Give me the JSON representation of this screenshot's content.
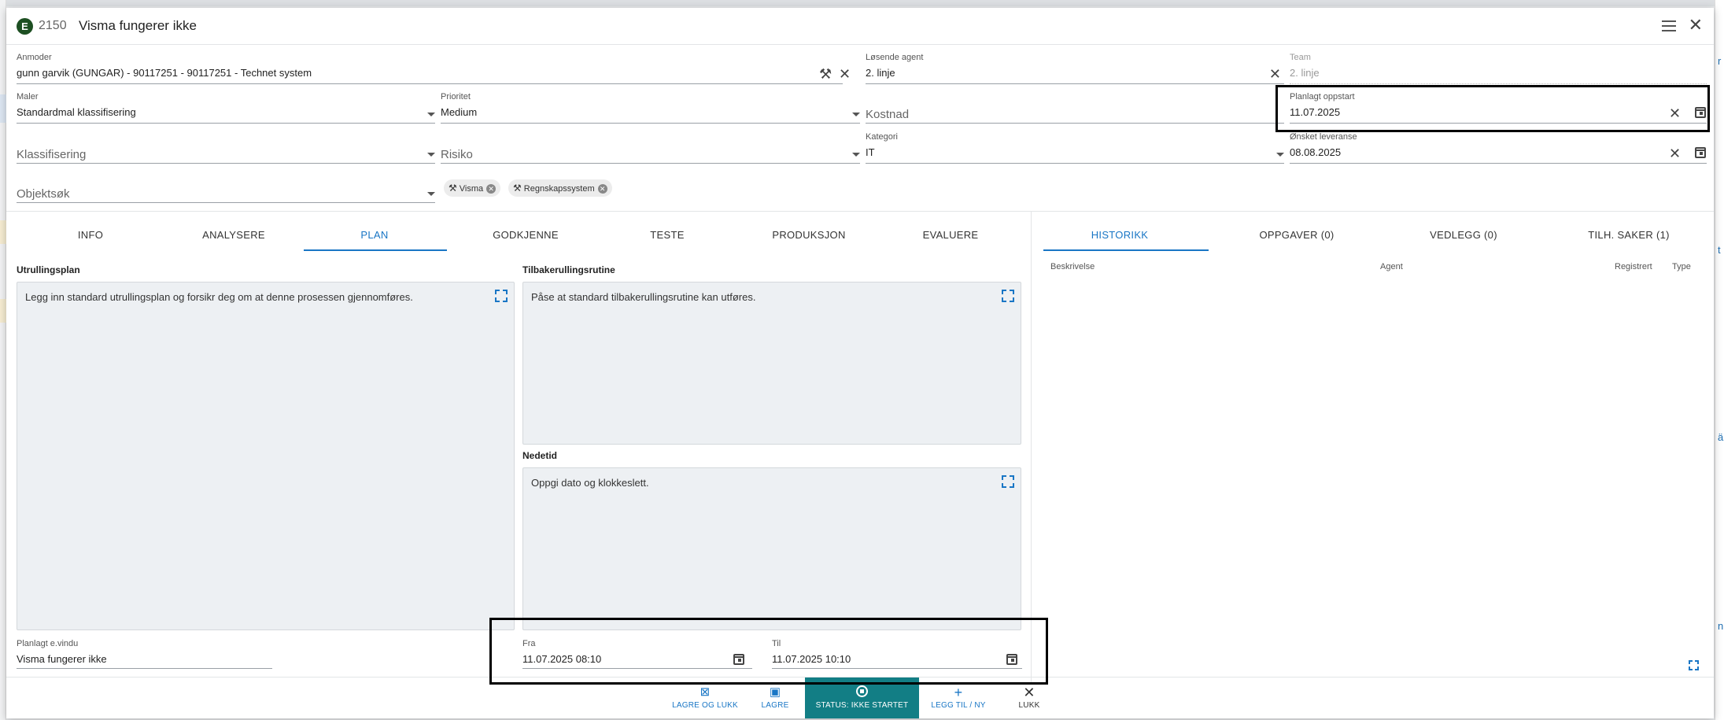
{
  "header": {
    "badge": "E",
    "ticket_number": "2150",
    "title": "Visma fungerer ikke"
  },
  "form": {
    "anmoder": {
      "label": "Anmoder",
      "value": "gunn garvik (GUNGAR) - 90117251 - 90117251 - Technet system"
    },
    "losende_agent": {
      "label": "Løsende agent",
      "value": "2. linje"
    },
    "team": {
      "label": "Team",
      "value": "2. linje"
    },
    "maler": {
      "label": "Maler",
      "value": "Standardmal klassifisering"
    },
    "prioritet": {
      "label": "Prioritet",
      "value": "Medium"
    },
    "kostnad": {
      "placeholder": "Kostnad"
    },
    "planlagt_oppstart": {
      "label": "Planlagt oppstart",
      "value": "11.07.2025"
    },
    "klassifisering": {
      "placeholder": "Klassifisering"
    },
    "risiko": {
      "placeholder": "Risiko"
    },
    "kategori": {
      "label": "Kategori",
      "value": "IT"
    },
    "onsket_leveranse": {
      "label": "Ønsket leveranse",
      "value": "08.08.2025"
    },
    "objektsok": {
      "placeholder": "Objektsøk"
    },
    "chips": [
      "Visma",
      "Regnskapssystem"
    ]
  },
  "left_tabs": [
    "INFO",
    "ANALYSERE",
    "PLAN",
    "GODKJENNE",
    "TESTE",
    "PRODUKSJON",
    "EVALUERE"
  ],
  "active_left_tab": "PLAN",
  "right_tabs": [
    "HISTORIKK",
    "OPPGAVER (0)",
    "VEDLEGG (0)",
    "TILH. SAKER (1)"
  ],
  "active_right_tab": "HISTORIKK",
  "plan": {
    "utrullingsplan": {
      "label": "Utrullingsplan",
      "text": "Legg inn standard utrullingsplan og forsikr deg om at denne prosessen gjennomføres."
    },
    "tilbakerulling": {
      "label": "Tilbakerullingsrutine",
      "text": "Påse at standard tilbakerullingsrutine kan utføres."
    },
    "nedetid": {
      "label": "Nedetid",
      "text": "Oppgi dato og klokkeslett."
    },
    "planlagt_evindu": {
      "label": "Planlagt e.vindu",
      "value": "Visma fungerer ikke"
    },
    "fra": {
      "label": "Fra",
      "value": "11.07.2025 08:10"
    },
    "til": {
      "label": "Til",
      "value": "11.07.2025 10:10"
    }
  },
  "history_columns": [
    "Beskrivelse",
    "Agent",
    "Registrert",
    "Type"
  ],
  "footer": {
    "lagre_og_lukk": "LAGRE OG LUKK",
    "lagre": "LAGRE",
    "status": "STATUS: IKKE STARTET",
    "legg_til_ny": "LEGG TIL / NY",
    "lukk": "LUKK"
  },
  "colors": {
    "accent": "#1976c5",
    "status_bg": "#127e85",
    "badge_bg": "#1d4f22",
    "field_bg": "#edf0f3"
  }
}
